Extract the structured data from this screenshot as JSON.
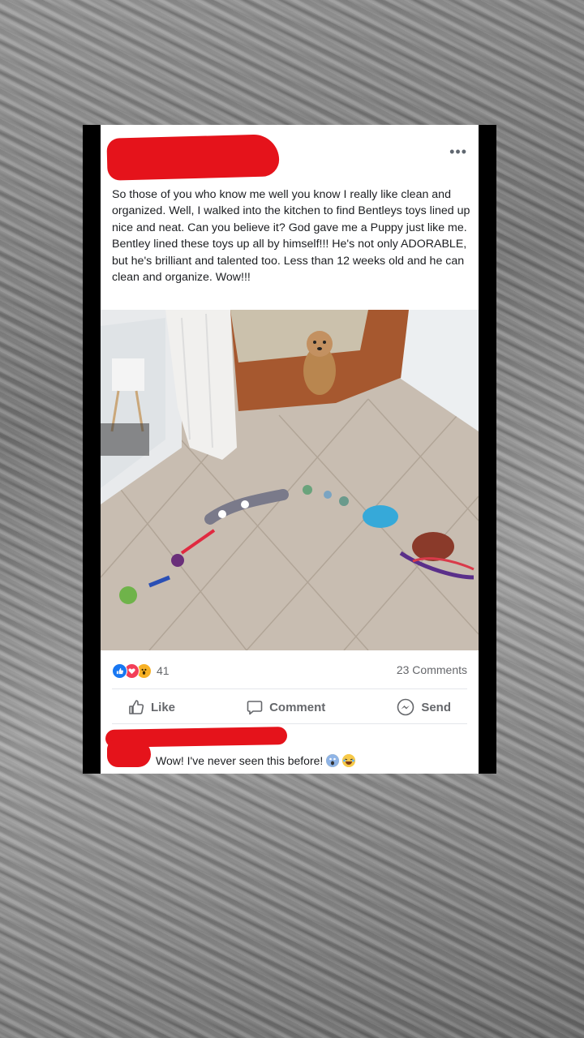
{
  "post": {
    "more_label": "•••",
    "text": "So those of you who know me well you know I really like clean and organized. Well, I walked into the kitchen to find Bentleys toys lined up nice and neat. Can you believe it? God gave me a Puppy just like me. Bentley lined these toys up all by himself!!! He's not only ADORABLE, but he's brilliant and talented too. Less than 12 weeks old and he can clean and organize. Wow!!!"
  },
  "stats": {
    "reaction_count": "41",
    "comments_label": "23 Comments",
    "reaction_icons": [
      "like-icon",
      "love-icon",
      "wow-icon"
    ]
  },
  "actions": {
    "like": "Like",
    "comment": "Comment",
    "send": "Send"
  },
  "comment": {
    "text": "Wow! I've never seen this before!",
    "emojis": [
      "scream-emoji",
      "laugh-emoji"
    ]
  },
  "colors": {
    "redaction": "#e5131b",
    "like_blue": "#1877f2",
    "love_red": "#f33e58",
    "wow_yellow": "#f7b125",
    "meta_gray": "#65676b"
  }
}
